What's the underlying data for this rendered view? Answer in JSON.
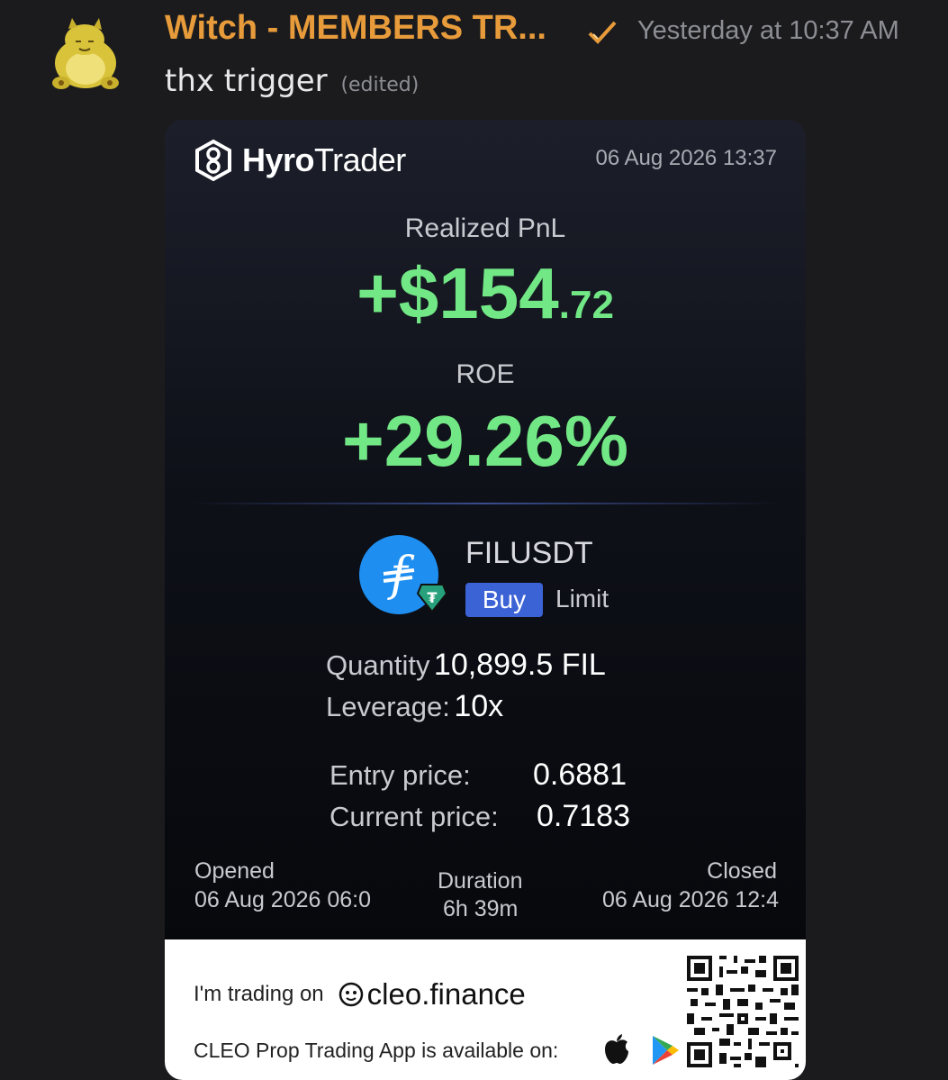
{
  "message": {
    "username": "Witch - MEMBERS TR...",
    "timestamp": "Yesterday at 10:37 AM",
    "text": "thx trigger",
    "edited": "(edited)"
  },
  "card": {
    "brand_prefix": "Hyro",
    "brand_suffix": "Trader",
    "date": "06 Aug 2026 13:37",
    "pnl_label": "Realized PnL",
    "pnl_main": "+$154",
    "pnl_cents": ".72",
    "roe_label": "ROE",
    "roe_value": "+29.26%",
    "pair": "FILUSDT",
    "side": "Buy",
    "order_type": "Limit",
    "quantity_label": "Quantity",
    "quantity_value": "10,899.5 FIL",
    "leverage_label": "Leverage:",
    "leverage_value": "10x",
    "entry_label": "Entry price:",
    "entry_value": "0.6881",
    "current_label": "Current price:",
    "current_value": "0.7183",
    "opened_label": "Opened",
    "opened_value": "06 Aug 2026 06:0",
    "duration_label": "Duration",
    "duration_value": "6h 39m",
    "closed_label": "Closed",
    "closed_value": "06 Aug 2026 12:4"
  },
  "footer": {
    "trading_on": "I'm trading on",
    "cleo_name": "cleo.finance",
    "available": "CLEO Prop Trading App is available on:"
  },
  "colors": {
    "username": "#e79b3a",
    "positive": "#72e785",
    "buy_badge": "#3c63d6"
  },
  "icons": [
    "avatar-snorlax",
    "verified-check-icon",
    "hyrotrader-logo-icon",
    "filecoin-icon",
    "tether-icon",
    "cleo-logo-icon",
    "apple-icon",
    "google-play-icon",
    "qr-code"
  ]
}
